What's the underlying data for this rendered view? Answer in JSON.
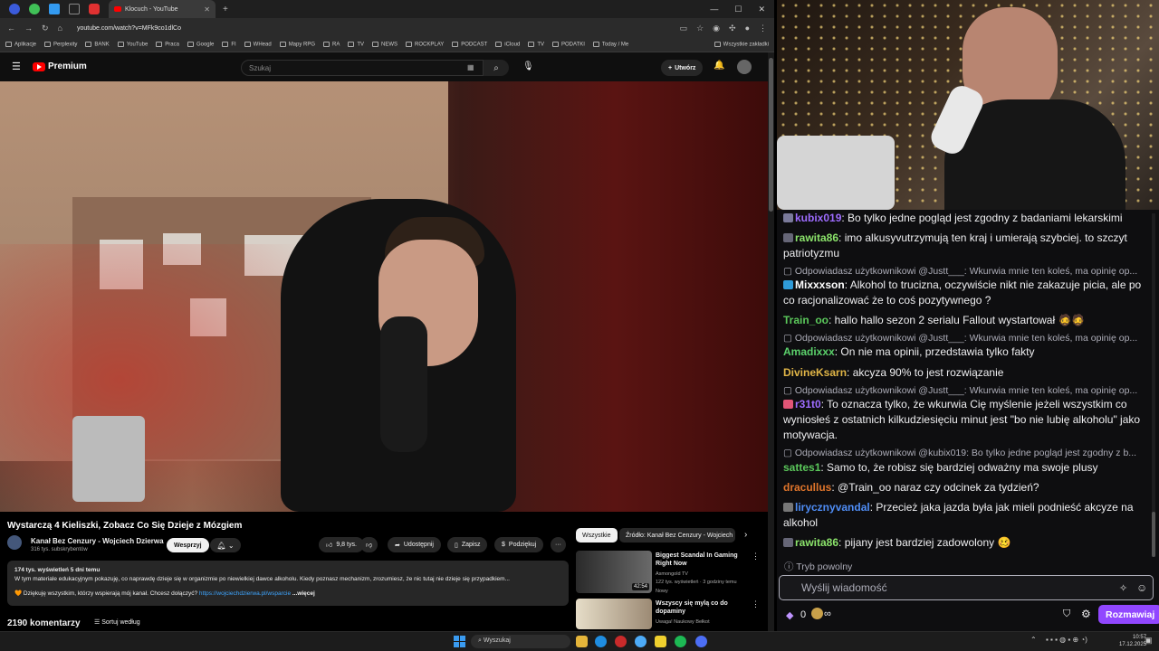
{
  "browser": {
    "active_tab": "Klocuch - YouTube",
    "url": "youtube.com/watch?v=MFk9co1dlCo",
    "bookmarks": [
      "Aplikacje",
      "Perplexity",
      "BANK",
      "YouTube",
      "Praca",
      "Google",
      "FI",
      "WHead",
      "Mapy RPG",
      "RA",
      "TV",
      "NEWS",
      "ROCKPLAY",
      "PODCAST",
      "iCloud",
      "TV",
      "PODATKI",
      "Today / Me"
    ],
    "all_bookmarks": "Wszystkie zakładki"
  },
  "youtube": {
    "logo": "Premium",
    "search_placeholder": "Szukaj",
    "create_label": "Utwórz",
    "video_title": "Wystarczą 4 Kieliszki, Zobacz Co Się Dzieje z Mózgiem",
    "channel_name": "Kanał Bez Cenzury - Wojciech Dzierwa",
    "channel_subs": "316 tys. subskrybentów",
    "support_label": "Wesprzyj",
    "likes": "9,8 tys.",
    "share_label": "Udostępnij",
    "save_label": "Zapisz",
    "thanks_label": "Podziękuj",
    "description_stats": "174 tys. wyświetleń  5 dni temu",
    "description_text": "W tym materiale edukacyjnym pokazuję, co naprawdę dzieje się w organizmie po niewielkiej dawce alkoholu. Kiedy poznasz mechanizm, zrozumiesz, że nic tutaj nie dzieje się przypadkiem...",
    "description_thanks": "Dziękuję wszystkim, którzy wspierają mój kanał. Chcesz dołączyć?",
    "description_link": "https://wojciechdzierwa.pl/wsparcie",
    "more_label": "...więcej",
    "comments_count": "2190 komentarzy",
    "sort_label": "Sortuj według",
    "chips": [
      "Wszystkie",
      "Źródło: Kanał Bez Cenzury - Wojciech"
    ],
    "recs": [
      {
        "title": "Biggest Scandal In Gaming Right Now",
        "channel": "Asmongold TV",
        "meta": "122 tys. wyświetleń · 3 godziny temu",
        "badge": "Nowy",
        "duration": "42:54"
      },
      {
        "title": "Wszyscy się mylą co do dopaminy",
        "channel": "Uwaga! Naukowy Bełkot",
        "meta": "",
        "badge": "",
        "duration": ""
      }
    ]
  },
  "taskbar": {
    "search_label": "Wyszukaj",
    "time": "10:57",
    "date": "17.12.2025"
  },
  "chat": {
    "messages": [
      {
        "type": "msg",
        "user": "kubix019",
        "color": "#9e6cff",
        "text": ": Bo tylko jedne pogląd jest zgodny z badaniami lekarskimi"
      },
      {
        "type": "msg",
        "user": "rawita86",
        "color": "#8be36b",
        "text": ": imo alkusyvutrzymują ten kraj i umierają szybciej. to szczyt patriotyzmu"
      },
      {
        "type": "reply",
        "text": "Odpowiadasz użytkownikowi @Justt___: Wkurwia mnie ten koleś, ma opinię op..."
      },
      {
        "type": "msg",
        "user": "Mixxxson",
        "color": "#ffffff",
        "text": ": Alkohol to trucizna, oczywiście nikt nie zakazuje picia, ale po co racjonalizować że to coś pozytywnego ?"
      },
      {
        "type": "msg",
        "user": "Train_oo",
        "color": "#5bc85b",
        "text": ": hallo hallo sezon 2 serialu Fallout wystartował"
      },
      {
        "type": "reply",
        "text": "Odpowiadasz użytkownikowi @Justt___: Wkurwia mnie ten koleś, ma opinię op..."
      },
      {
        "type": "msg",
        "user": "Amadixxx",
        "color": "#5bd16b",
        "text": ": On nie ma opinii, przedstawia tylko fakty"
      },
      {
        "type": "msg",
        "user": "DivineKsarn",
        "color": "#e0b547",
        "text": ": akcyza 90% to jest rozwiązanie"
      },
      {
        "type": "reply",
        "text": "Odpowiadasz użytkownikowi @Justt___: Wkurwia mnie ten koleś, ma opinię op..."
      },
      {
        "type": "msg",
        "user": "r31t0",
        "color": "#9e6cff",
        "text": ": To oznacza tylko, że wkurwia Cię myślenie jeżeli wszystkim co wyniosłeś z ostatnich kilkudziesięciu minut jest \"bo nie lubię alkoholu\" jako motywacja."
      },
      {
        "type": "reply",
        "text": "Odpowiadasz użytkownikowi @kubix019: Bo tylko jedne pogląd jest zgodny z b..."
      },
      {
        "type": "msg",
        "user": "sattes1",
        "color": "#5bc85b",
        "text": ": Samo to, że robisz się bardziej odważny ma swoje plusy"
      },
      {
        "type": "msg",
        "user": "dracullus",
        "color": "#e0752b",
        "text": ": @Train_oo naraz czy odcinek za tydzień?"
      },
      {
        "type": "msg",
        "user": "lirycznyvandal",
        "color": "#4f8df5",
        "text": ": Przecież jaka jazda była jak mieli podnieść akcyze na alkohol"
      },
      {
        "type": "msg",
        "user": "rawita86",
        "color": "#8be36b",
        "text": ": pijany jest bardziej zadowolony"
      }
    ],
    "slow_mode": "Tryb powolny",
    "input_placeholder": "Wyślij wiadomość",
    "points": "0",
    "send_label": "Rozmawiaj"
  }
}
